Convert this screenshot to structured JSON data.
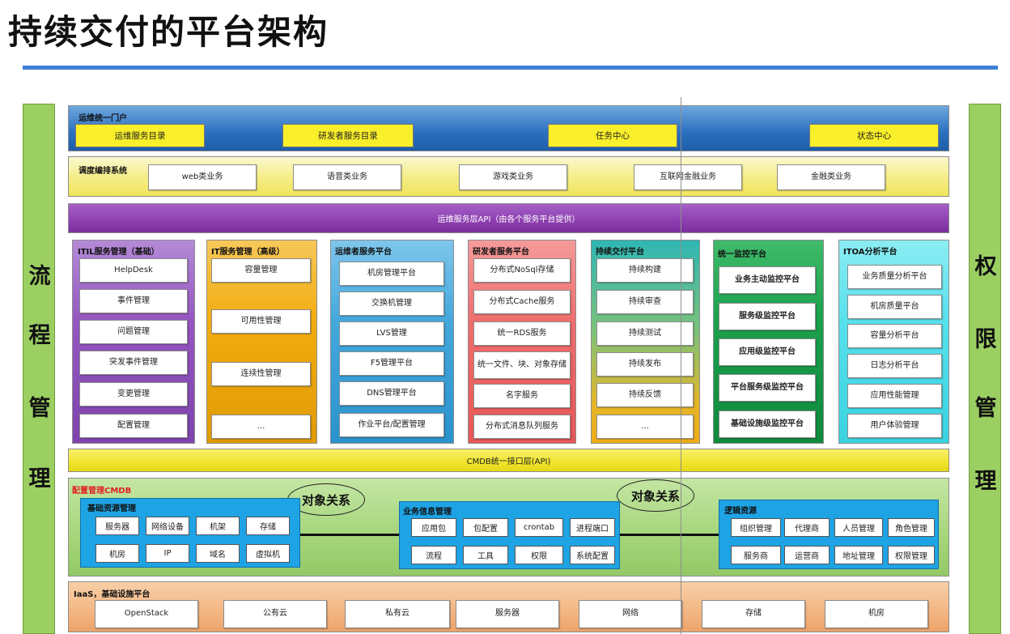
{
  "title": "持续交付的平台架构",
  "sidebars": {
    "left": [
      "流",
      "程",
      "管",
      "理"
    ],
    "right": [
      "权",
      "限",
      "管",
      "理"
    ]
  },
  "portal": {
    "label": "运维统一门户",
    "items": [
      "运维服务目录",
      "研发者服务目录",
      "任务中心",
      "状态中心"
    ]
  },
  "scheduler": {
    "label": "调度编排系统",
    "items": [
      "web类业务",
      "语音类业务",
      "游戏类业务",
      "互联网金融业务",
      "金融类业务"
    ]
  },
  "api_layer": "运维服务层API（由各个服务平台提供）",
  "platforms": [
    {
      "title": "ITIL服务管理（基础）",
      "items": [
        "HelpDesk",
        "事件管理",
        "问题管理",
        "突发事件管理",
        "变更管理",
        "配置管理"
      ]
    },
    {
      "title": "IT服务管理（高级）",
      "items": [
        "容量管理",
        "可用性管理",
        "连续性管理",
        "..."
      ]
    },
    {
      "title": "运维者服务平台",
      "items": [
        "机房管理平台",
        "交换机管理",
        "LVS管理",
        "F5管理平台",
        "DNS管理平台",
        "作业平台/配置管理"
      ]
    },
    {
      "title": "研发者服务平台",
      "items": [
        "分布式NoSql存储",
        "分布式Cache服务",
        "统一RDS服务",
        "统一文件、块、对象存储",
        "名字服务",
        "分布式消息队列服务"
      ]
    },
    {
      "title": "持续交付平台",
      "items": [
        "持续构建",
        "持续审查",
        "持续测试",
        "持续发布",
        "持续反馈",
        "..."
      ]
    },
    {
      "title": "统一监控平台",
      "items": [
        "业务主动监控平台",
        "服务级监控平台",
        "应用级监控平台",
        "平台服务级监控平台",
        "基础设施级监控平台"
      ]
    },
    {
      "title": "ITOA分析平台",
      "items": [
        "业务质量分析平台",
        "机房质量平台",
        "容量分析平台",
        "日志分析平台",
        "应用性能管理",
        "用户体验管理"
      ]
    }
  ],
  "cmdb_api": "CMDB统一接口层(API)",
  "cmdb": {
    "label": "配置管理CMDB",
    "relation": "对象关系",
    "groups": [
      {
        "title": "基础资源管理",
        "rows": [
          [
            "服务器",
            "网络设备",
            "机架",
            "存储"
          ],
          [
            "机房",
            "IP",
            "域名",
            "虚拟机"
          ]
        ]
      },
      {
        "title": "业务信息管理",
        "rows": [
          [
            "应用包",
            "包配置",
            "crontab",
            "进程端口"
          ],
          [
            "流程",
            "工具",
            "权限",
            "系统配置"
          ]
        ]
      },
      {
        "title": "逻辑资源",
        "rows": [
          [
            "组织管理",
            "代理商",
            "人员管理",
            "角色管理"
          ],
          [
            "服务商",
            "运营商",
            "地址管理",
            "权限管理"
          ]
        ]
      }
    ]
  },
  "iaas": {
    "label": "IaaS，基础设施平台",
    "items": [
      "OpenStack",
      "公有云",
      "私有云",
      "服务器",
      "网络",
      "存储",
      "机房"
    ]
  },
  "colors": {
    "portal": "#2f78c4",
    "scheduler": "#f5ee8a",
    "api": "#8d3fb0",
    "itil": "#9457c0",
    "itsm": "#f2ac0e",
    "ops": "#44a8dc",
    "dev": "#ef6e6e",
    "cd": "#31b5b1",
    "monitor": "#1ba04c",
    "itoa": "#57e0ec",
    "cmdb": "#a5d57a",
    "cmdb_group": "#1ea3e5",
    "iaas": "#f3b683",
    "sidebar": "#9ccf62"
  }
}
